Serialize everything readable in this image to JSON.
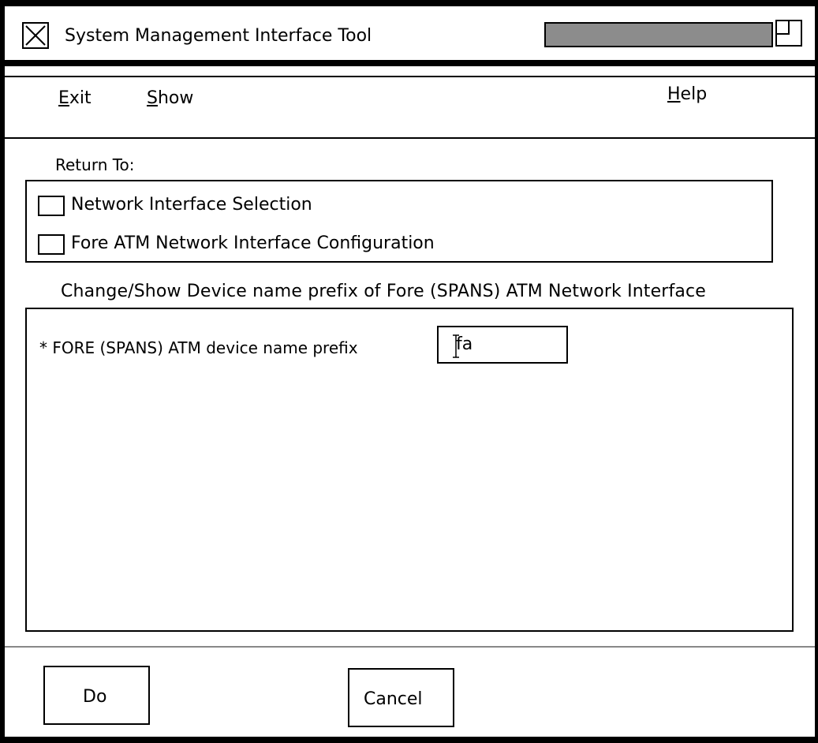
{
  "window": {
    "title": "System Management Interface Tool"
  },
  "menubar": {
    "items": [
      {
        "mnemonic": "E",
        "rest": "xit"
      },
      {
        "mnemonic": "S",
        "rest": "how"
      },
      {
        "mnemonic": "H",
        "rest": "elp"
      }
    ]
  },
  "return_to": {
    "label": "Return To:",
    "options": [
      {
        "label": "Network Interface Selection",
        "checked": false
      },
      {
        "label": "Fore ATM Network Interface Configuration",
        "checked": false
      }
    ]
  },
  "form": {
    "section_title": "Change/Show Device name prefix of Fore (SPANS) ATM Network Interface",
    "fields": [
      {
        "label": "* FORE (SPANS) ATM device name prefix",
        "value": "fa"
      }
    ]
  },
  "buttons": {
    "do": "Do",
    "cancel": "Cancel"
  }
}
